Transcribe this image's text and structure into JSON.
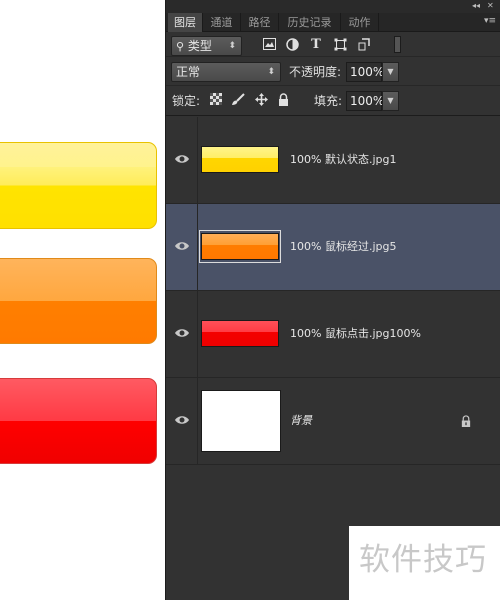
{
  "panel": {
    "tabs": [
      {
        "label": "图层",
        "active": true
      },
      {
        "label": "通道",
        "active": false
      },
      {
        "label": "路径",
        "active": false
      },
      {
        "label": "历史记录",
        "active": false
      },
      {
        "label": "动作",
        "active": false
      }
    ],
    "filter": {
      "kind_label": "类型"
    },
    "blend": {
      "mode": "正常",
      "opacity_label": "不透明度:",
      "opacity_value": "100%"
    },
    "lock": {
      "label": "锁定:",
      "fill_label": "填充:",
      "fill_value": "100%"
    },
    "layers": [
      {
        "name": "100%  默认状态.jpg1",
        "visible": true,
        "selected": false
      },
      {
        "name": "100%  鼠标经过.jpg5",
        "visible": true,
        "selected": true
      },
      {
        "name": "100% 鼠标点击.jpg100%",
        "visible": true,
        "selected": false
      },
      {
        "name": "背景",
        "visible": true,
        "selected": false,
        "locked": true
      }
    ]
  },
  "canvas": {
    "buttons": [
      {
        "state": "default",
        "color": "#ffe400"
      },
      {
        "state": "hover",
        "color": "#ff7f00"
      },
      {
        "state": "pressed",
        "color": "#ff0000"
      }
    ]
  },
  "watermark": {
    "text": "软件技巧"
  }
}
